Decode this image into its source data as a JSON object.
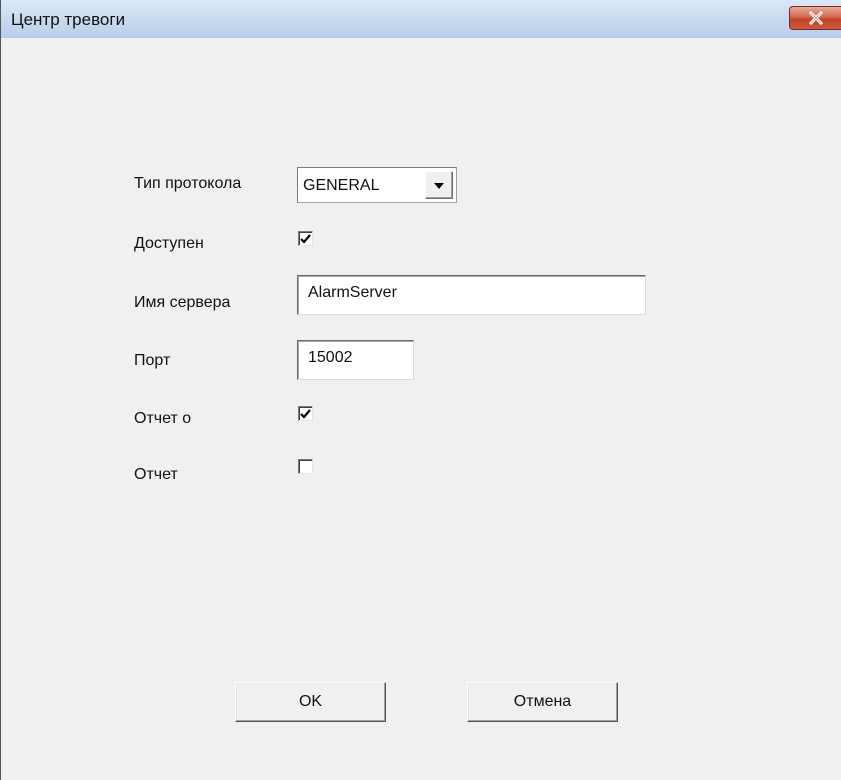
{
  "window": {
    "title": "Центр тревоги"
  },
  "form": {
    "protocol_type": {
      "label": "Тип протокола",
      "selected": "GENERAL"
    },
    "enabled": {
      "label": "Доступен",
      "checked": true
    },
    "server_name": {
      "label": "Имя сервера",
      "value": "AlarmServer"
    },
    "port": {
      "label": "Порт",
      "value": "15002"
    },
    "report_about": {
      "label": "Отчет о",
      "checked": true
    },
    "report": {
      "label": "Отчет",
      "checked": false
    }
  },
  "buttons": {
    "ok_label": "OK",
    "cancel_label": "Отмена"
  },
  "icons": {
    "close": "close-icon",
    "dropdown": "chevron-down-icon",
    "checkmark": "checkmark-icon"
  }
}
